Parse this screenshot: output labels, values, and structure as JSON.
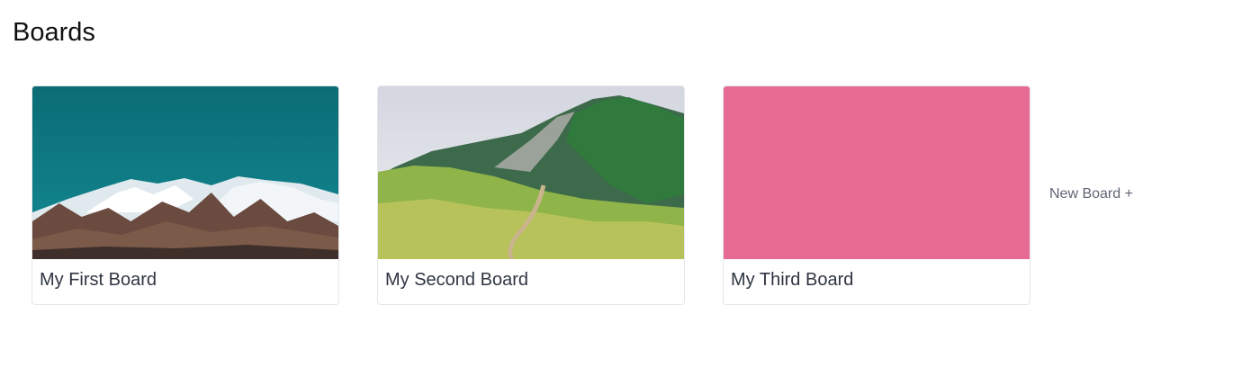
{
  "page": {
    "title": "Boards"
  },
  "boards": [
    {
      "name": "My First Board",
      "cover": "photo-snowy-mountains"
    },
    {
      "name": "My Second Board",
      "cover": "photo-green-hills"
    },
    {
      "name": "My Third Board",
      "cover": "solid-color",
      "cover_color": "#e76a93"
    }
  ],
  "actions": {
    "new_board_label": "New Board +"
  }
}
